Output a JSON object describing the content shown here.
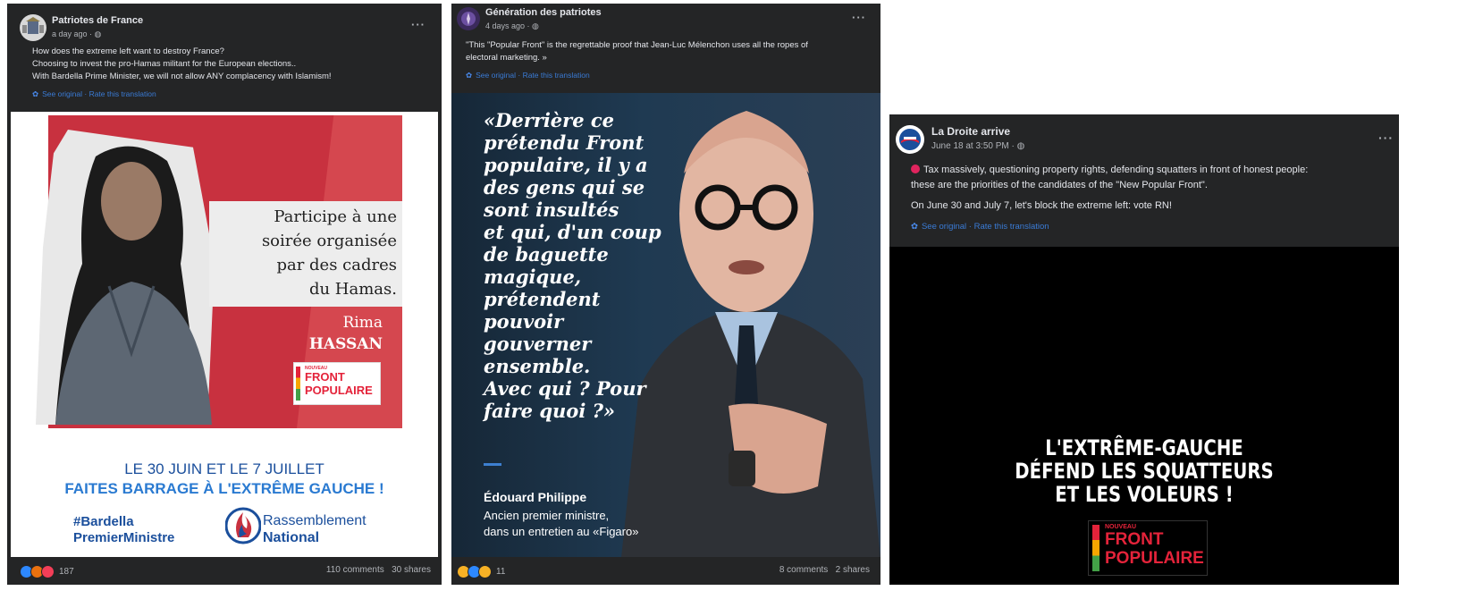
{
  "posts": [
    {
      "page_name": "Patriotes de France",
      "meta": "a day ago · ",
      "text_lines": [
        "How does the extreme left want to destroy France?",
        "Choosing to invest the pro-Hamas militant for the European elections..",
        "With Bardella Prime Minister, we will not allow ANY complacency with Islamism!"
      ],
      "translation": "See original · Rate this translation",
      "image": {
        "quote": [
          "Participe à une",
          "soirée organisée",
          "par des cadres",
          "du Hamas."
        ],
        "person_first": "Rima",
        "person_last": "HASSAN",
        "badge": [
          "NOUVEAU",
          "FRONT",
          "POPULAIRE"
        ],
        "dates": "LE 30 JUIN ET LE 7 JUILLET",
        "slogan": "FAITES BARRAGE À L'EXTRÊME GAUCHE !",
        "hashtag": [
          "#Bardella",
          "PremierMinistre"
        ],
        "party": [
          "Rassemblement",
          "National"
        ]
      },
      "reaction_count": "187",
      "comments": "110 comments",
      "shares": "30 shares"
    },
    {
      "page_name": "Génération des patriotes",
      "meta": "4 days ago · ",
      "text_lines": [
        "\"This \"Popular Front\" is the regrettable proof that Jean-Luc Mélenchon uses all the ropes of",
        "electoral marketing. »"
      ],
      "translation": "See original · Rate this translation",
      "image": {
        "quote": [
          "«Derrière ce",
          "prétendu Front",
          "populaire, il y a",
          "des gens qui se",
          "sont insultés",
          "et qui, d'un coup",
          "de baguette",
          "magique,",
          "prétendent",
          "pouvoir",
          "gouverner",
          "ensemble.",
          "Avec qui ? Pour",
          "faire quoi ?»"
        ],
        "speaker": "Édouard Philippe",
        "role": [
          "Ancien premier ministre,",
          "dans un entretien au «Figaro»"
        ]
      },
      "reaction_count": "11",
      "comments": "8 comments",
      "shares": "2 shares"
    },
    {
      "page_name": "La Droite arrive",
      "meta": "June 18 at 3:50 PM · ",
      "text_lines": [
        "Tax massively, questioning property rights, defending squatters in front of honest people:",
        "these are the priorities of the candidates of the \"New Popular Front\"."
      ],
      "text_second": "On June 30 and July 7, let's block the extreme left: vote RN!",
      "translation": "See original · Rate this translation",
      "image": {
        "headline": [
          "L'EXTRÊME-GAUCHE",
          "DÉFEND LES SQUATTEURS",
          "ET LES VOLEURS !"
        ],
        "badge": [
          "NOUVEAU",
          "FRONT",
          "POPULAIRE"
        ]
      }
    }
  ],
  "colors": {
    "card_bg": "#242526",
    "text": "#e4e6eb",
    "muted": "#b0b3b8",
    "link": "#3a7bd5",
    "rn_red": "#c8313f",
    "rn_blue": "#1b4f9c",
    "nfp_red": "#e4233a"
  }
}
